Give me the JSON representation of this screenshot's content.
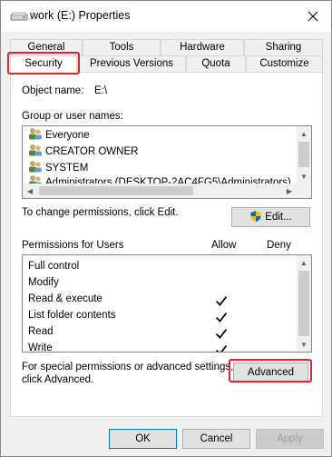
{
  "window": {
    "title": "work (E:) Properties",
    "icon": "drive-icon"
  },
  "tabs": {
    "row_top": [
      {
        "label": "General"
      },
      {
        "label": "Tools"
      },
      {
        "label": "Hardware"
      },
      {
        "label": "Sharing"
      }
    ],
    "row_bottom": [
      {
        "label": "Security",
        "active": true
      },
      {
        "label": "Previous Versions"
      },
      {
        "label": "Quota"
      },
      {
        "label": "Customize"
      }
    ]
  },
  "security": {
    "object_name_label": "Object name:",
    "object_name_value": "E:\\",
    "group_label": "Group or user names:",
    "groups": [
      {
        "name": "Everyone"
      },
      {
        "name": "CREATOR OWNER"
      },
      {
        "name": "SYSTEM"
      },
      {
        "name": "Administrators (DESKTOP-2AC4FG5\\Administrators)"
      }
    ],
    "change_text": "To change permissions, click Edit.",
    "edit_button": "Edit...",
    "permissions_label": "Permissions for Users",
    "allow_header": "Allow",
    "deny_header": "Deny",
    "permissions": [
      {
        "name": "Full control",
        "allow": false,
        "deny": false
      },
      {
        "name": "Modify",
        "allow": false,
        "deny": false
      },
      {
        "name": "Read & execute",
        "allow": true,
        "deny": false
      },
      {
        "name": "List folder contents",
        "allow": true,
        "deny": false
      },
      {
        "name": "Read",
        "allow": true,
        "deny": false
      },
      {
        "name": "Write",
        "allow": true,
        "deny": false
      }
    ],
    "special_text_line1": "For special permissions or advanced settings,",
    "special_text_line2": "click Advanced.",
    "advanced_button": "Advanced"
  },
  "footer": {
    "ok_button": "OK",
    "cancel_button": "Cancel",
    "apply_button": "Apply"
  },
  "colors": {
    "highlight": "#e8202a",
    "accent": "#0078d7"
  }
}
